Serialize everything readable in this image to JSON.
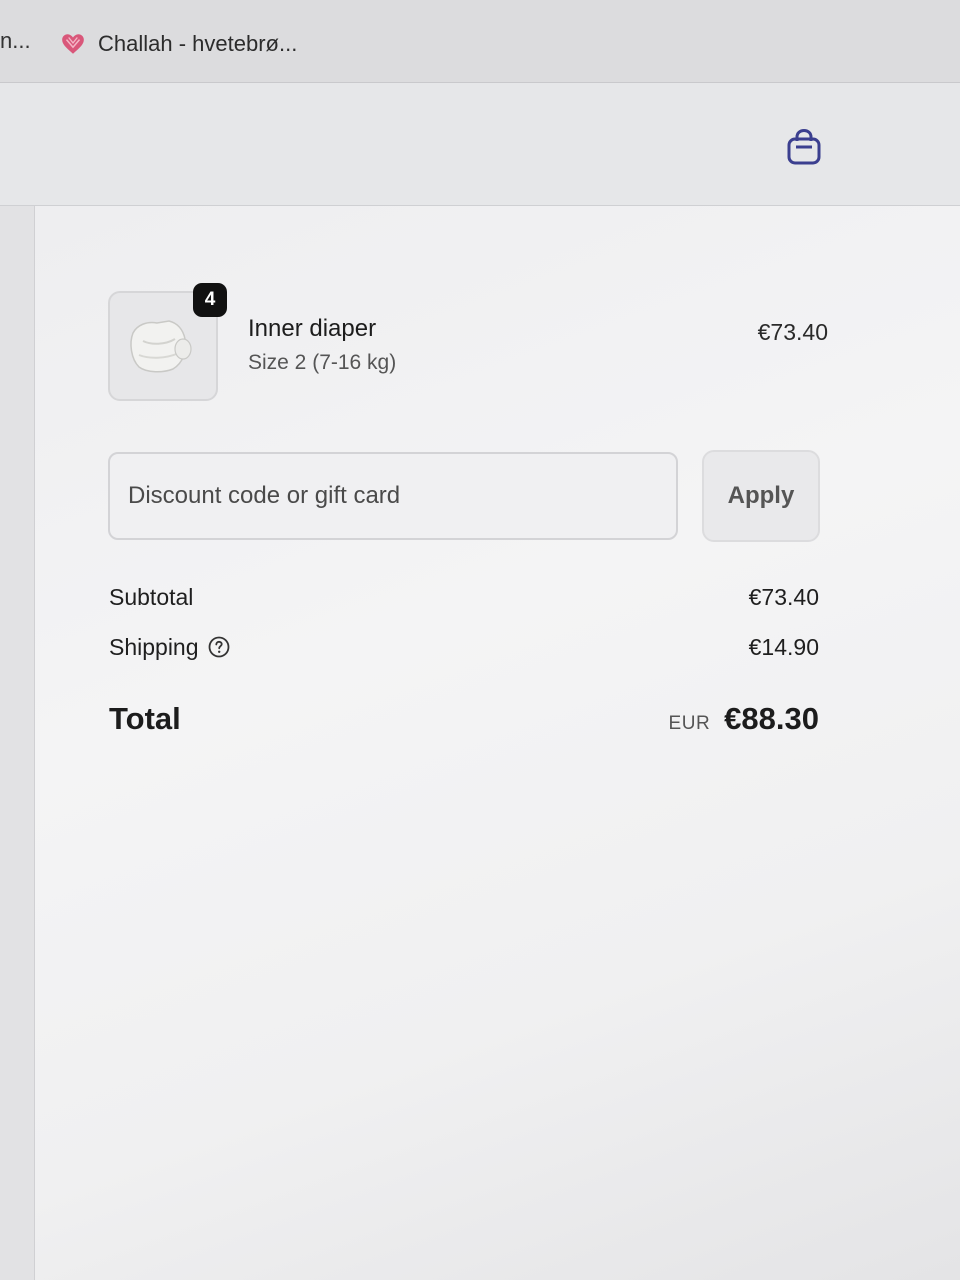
{
  "browser": {
    "truncated_tab_label": "n...",
    "tab_title": "Challah - hvetebrø..."
  },
  "header": {
    "cart_icon": "shopping-bag-icon"
  },
  "order_summary": {
    "item": {
      "quantity": "4",
      "name": "Inner diaper",
      "variant": "Size 2 (7-16 kg)",
      "price": "€73.40"
    },
    "discount": {
      "placeholder": "Discount code or gift card",
      "value": "",
      "apply_label": "Apply"
    },
    "subtotal": {
      "label": "Subtotal",
      "value": "€73.40"
    },
    "shipping": {
      "label": "Shipping",
      "value": "€14.90",
      "help_icon": "question-circle-icon"
    },
    "total": {
      "label": "Total",
      "currency": "EUR",
      "value": "€88.30"
    }
  },
  "colors": {
    "accent": "#3b3f8f",
    "badge": "#111111",
    "favicon": "#d9577a"
  }
}
